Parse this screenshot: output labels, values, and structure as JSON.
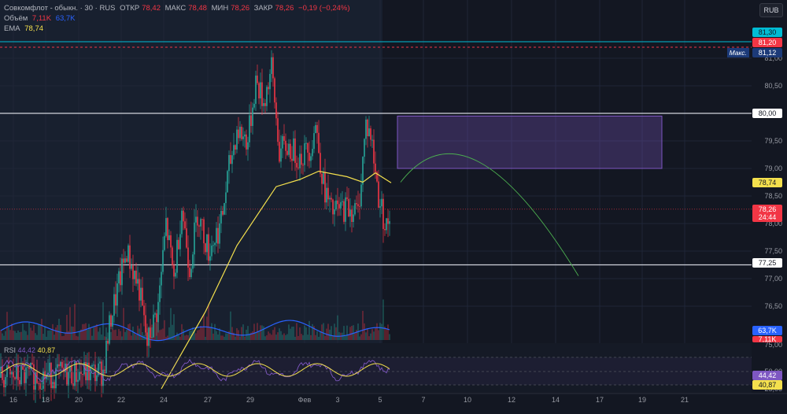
{
  "header": {
    "symbol": "Совкомфлот - обыкн. · 30 · RUS",
    "open_label": "ОТКР",
    "open": "78,42",
    "high_label": "МАКС",
    "high": "78,48",
    "low_label": "МИН",
    "low": "78,26",
    "close_label": "ЗАКР",
    "close": "78,26",
    "change": "−0,19 (−0,24%)",
    "volume_label": "Объём",
    "volume": "7,11K",
    "volume_ma": "63,7K",
    "ema_label": "EMA",
    "ema": "78,74"
  },
  "currency_button": "RUB",
  "rsi": {
    "label": "RSI",
    "value": "44,42",
    "ma": "40,87",
    "levels": [
      "75,00",
      "50,00",
      "25,00"
    ]
  },
  "price_axis": [
    "81,00",
    "80,50",
    "79,50",
    "79,00",
    "78,50",
    "78,00",
    "77,50",
    "77,00",
    "76,50"
  ],
  "tags": {
    "cyan": "81,30",
    "red_top": "81,20",
    "max_label": "Макс.",
    "max": "81,12",
    "level_80": "80,00",
    "ema": "78,74",
    "last": "78,26",
    "countdown": "24:44",
    "level_7725": "77,25",
    "vol_ma": "63,7K",
    "vol": "7,11K"
  },
  "time_axis": [
    "16",
    "18",
    "20",
    "22",
    "24",
    "27",
    "29",
    "Фев",
    "3",
    "5",
    "7",
    "10",
    "12",
    "14",
    "17",
    "19",
    "21"
  ],
  "colors": {
    "up": "#26a69a",
    "down": "#f23645",
    "ema": "#f4e04d",
    "vol_ma": "#2962ff",
    "rsi": "#7e57c2",
    "rsi_ma": "#f4e04d",
    "zone": "#7e57c2"
  },
  "chart_data": {
    "type": "candlestick",
    "title": "Совкомфлот - обыкн. 30m",
    "ylim": [
      74.9,
      81.6
    ],
    "horizontal_levels": [
      81.3,
      81.2,
      80.0,
      78.26,
      77.25
    ],
    "close_path": [
      [
        0,
        75.2
      ],
      [
        65,
        75.3
      ],
      [
        70,
        76.3
      ],
      [
        80,
        77.5
      ],
      [
        88,
        76.8
      ],
      [
        93,
        75.8
      ],
      [
        100,
        76.5
      ],
      [
        105,
        78.0
      ],
      [
        110,
        77.0
      ],
      [
        115,
        78.3
      ],
      [
        120,
        77.2
      ],
      [
        125,
        78.2
      ],
      [
        132,
        77.5
      ],
      [
        140,
        78.0
      ],
      [
        145,
        79.0
      ],
      [
        150,
        79.7
      ],
      [
        157,
        79.5
      ],
      [
        162,
        80.6
      ],
      [
        167,
        80.2
      ],
      [
        172,
        80.8
      ],
      [
        177,
        79.3
      ],
      [
        182,
        79.4
      ],
      [
        190,
        79.2
      ],
      [
        197,
        79.4
      ],
      [
        200,
        79.8
      ],
      [
        205,
        78.7
      ],
      [
        210,
        78.2
      ],
      [
        220,
        78.3
      ],
      [
        227,
        78.2
      ],
      [
        232,
        79.8
      ],
      [
        235,
        79.6
      ],
      [
        240,
        78.5
      ],
      [
        245,
        77.9
      ],
      [
        248,
        78.26
      ]
    ],
    "ema_path": [
      [
        102,
        75.0
      ],
      [
        130,
        76.4
      ],
      [
        150,
        77.6
      ],
      [
        175,
        78.67
      ],
      [
        190,
        78.8
      ],
      [
        202,
        78.95
      ],
      [
        220,
        78.85
      ],
      [
        230,
        78.75
      ],
      [
        238,
        78.92
      ],
      [
        248,
        78.74
      ]
    ],
    "forecast_zone": {
      "price_from": 79.0,
      "price_to": 79.95
    },
    "forecast_arc": [
      [
        254,
        78.75
      ],
      [
        297,
        79.55
      ],
      [
        367,
        77.05
      ]
    ]
  }
}
